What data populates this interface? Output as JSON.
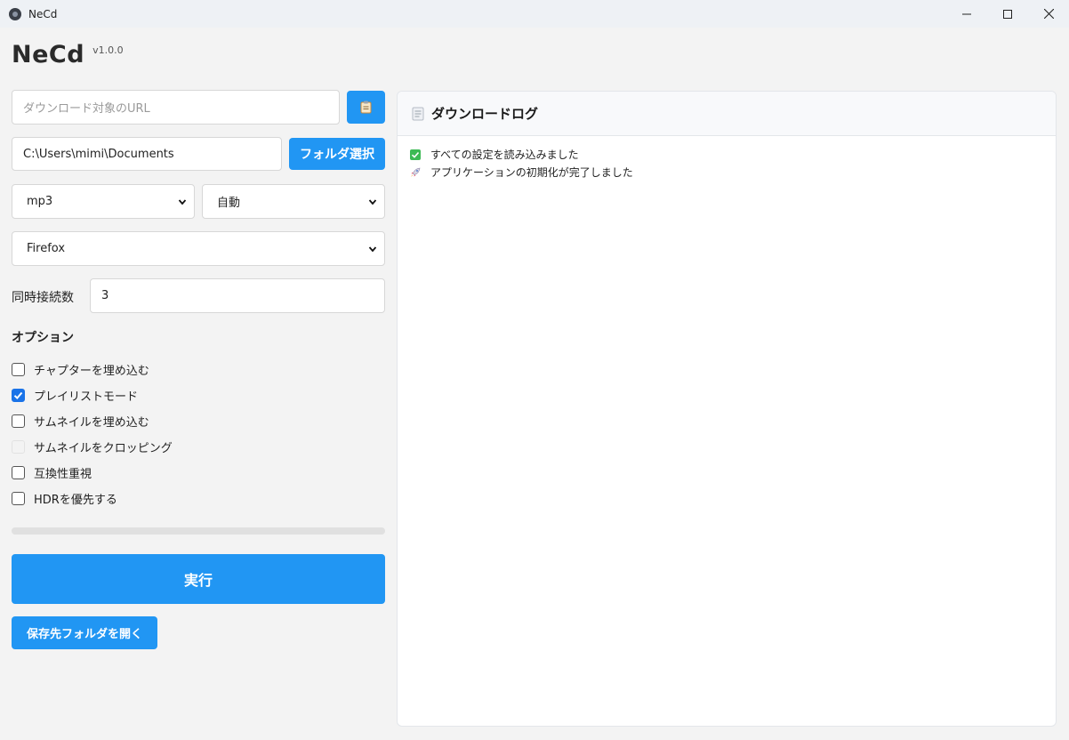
{
  "window": {
    "title": "NeCd"
  },
  "header": {
    "app_name": "NeCd",
    "version": "v1.0.0"
  },
  "url_input": {
    "value": "",
    "placeholder": "ダウンロード対象のURL"
  },
  "paste_button": {
    "icon": "clipboard-icon"
  },
  "folder": {
    "path": "C:\\Users\\mimi\\Documents",
    "select_label": "フォルダ選択"
  },
  "format_select": {
    "selected": "mp3"
  },
  "quality_select": {
    "selected": "自動"
  },
  "browser_select": {
    "selected": "Firefox"
  },
  "connections": {
    "label": "同時接続数",
    "value": "3"
  },
  "options": {
    "title": "オプション",
    "items": [
      {
        "label": "チャプターを埋め込む",
        "checked": false,
        "disabled": false
      },
      {
        "label": "プレイリストモード",
        "checked": true,
        "disabled": false
      },
      {
        "label": "サムネイルを埋め込む",
        "checked": false,
        "disabled": false
      },
      {
        "label": "サムネイルをクロッピング",
        "checked": false,
        "disabled": true
      },
      {
        "label": "互換性重視",
        "checked": false,
        "disabled": false
      },
      {
        "label": "HDRを優先する",
        "checked": false,
        "disabled": false
      }
    ]
  },
  "progress": {
    "value": 0
  },
  "run_button": {
    "label": "実行"
  },
  "open_folder_button": {
    "label": "保存先フォルダを開く"
  },
  "log": {
    "title": "ダウンロードログ",
    "entries": [
      {
        "icon": "check-mark-icon",
        "text": "すべての設定を読み込みました"
      },
      {
        "icon": "rocket-icon",
        "text": "アプリケーションの初期化が完了しました"
      }
    ]
  },
  "colors": {
    "accent": "#2196f3",
    "checkbox": "#1a73e8",
    "success": "#3cba54"
  }
}
